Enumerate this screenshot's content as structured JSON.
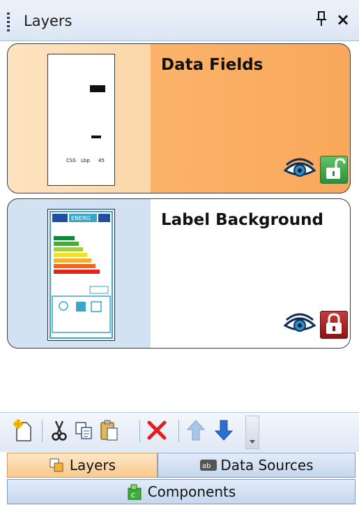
{
  "panel": {
    "title": "Layers",
    "pin_glyph": "ԩ",
    "close_glyph": "×"
  },
  "layers": [
    {
      "name": "Data Fields",
      "selected": true,
      "visible_icon": "eye-icon",
      "lock_icon": "unlocked-padlock-icon",
      "lock_color": "#3aa047",
      "thumb_texts": [
        "CSS",
        "Lbp",
        "45"
      ]
    },
    {
      "name": "Label Background",
      "selected": false,
      "visible_icon": "eye-icon",
      "lock_icon": "locked-padlock-icon",
      "lock_color": "#a11c1c",
      "thumb_texts": [
        "ENERG"
      ]
    }
  ],
  "toolbar": {
    "items": [
      "new-layer-icon",
      "cut-icon",
      "copy-icon",
      "paste-icon",
      "delete-icon",
      "move-up-icon",
      "move-down-icon"
    ]
  },
  "tabs": [
    {
      "label": "Layers",
      "active": true,
      "icon": "layers-icon"
    },
    {
      "label": "Data Sources",
      "active": false,
      "icon": "data-sources-icon"
    },
    {
      "label": "Components",
      "active": false,
      "icon": "components-icon"
    }
  ],
  "colors": {
    "selected_bg": "#f9a85b",
    "accent_blue": "#2c6fd1",
    "tab_active": "#f9c98d"
  }
}
